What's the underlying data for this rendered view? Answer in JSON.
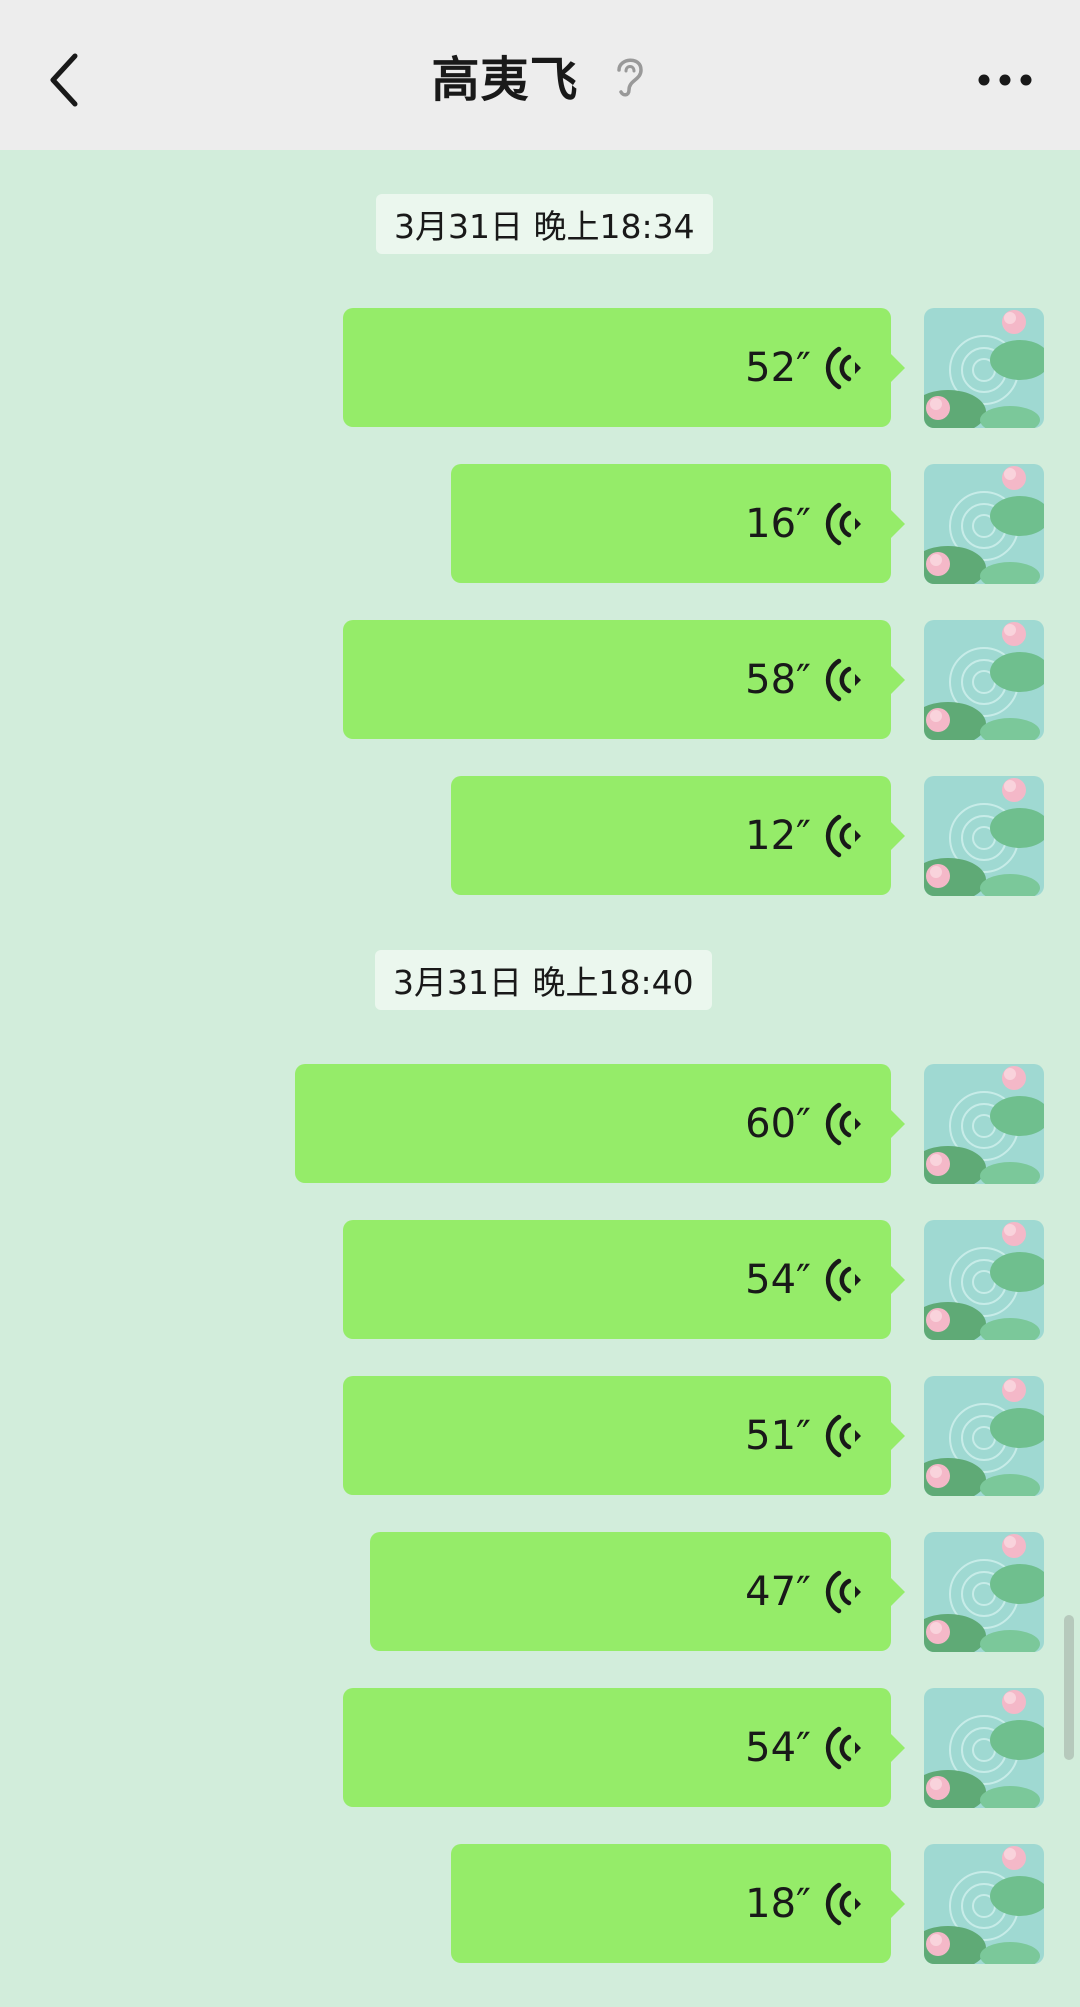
{
  "header": {
    "title": "高夷飞",
    "back_icon": "chevron-left-icon",
    "earpiece_icon": "ear-icon",
    "more_icon": "more-dots-icon"
  },
  "timestamps": [
    {
      "label": "3月31日 晚上18:34"
    },
    {
      "label": "3月31日 晚上18:40"
    }
  ],
  "messages": [
    {
      "duration": "52″"
    },
    {
      "duration": "16″"
    },
    {
      "duration": "58″"
    },
    {
      "duration": "12″"
    },
    {
      "duration": "60″"
    },
    {
      "duration": "54″"
    },
    {
      "duration": "51″"
    },
    {
      "duration": "47″"
    },
    {
      "duration": "54″"
    },
    {
      "duration": "18″"
    }
  ],
  "colors": {
    "background": "#d2eddb",
    "bubble": "#95ec69",
    "header": "#ededed"
  }
}
